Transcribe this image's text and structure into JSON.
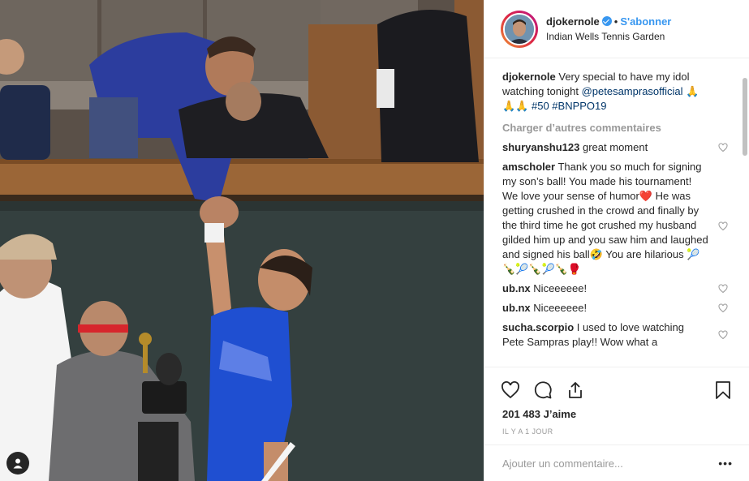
{
  "post": {
    "username": "djokernole",
    "follow_label": "S'abonner",
    "separator": "•",
    "location": "Indian Wells Tennis Garden"
  },
  "caption": {
    "username": "djokernole",
    "text_1": "Very special to have my idol watching tonight",
    "mention": "@petesamprasofficial",
    "text_2": "🙏 🙏🙏",
    "tags": "#50 #BNPPO19"
  },
  "load_more_label": "Charger d’autres commentaires",
  "comments": [
    {
      "username": "shuryanshu123",
      "text": "great moment"
    },
    {
      "username": "amscholer",
      "text": "Thank you so much for signing my son’s ball! You made his tournament! We love your sense of humor❤️ He was getting crushed in the crowd and finally by the third time he got crushed my husband gilded him up and you saw him and laughed and signed his ball🤣 You are hilarious 🎾🍾🎾🍾🎾🍾🥊"
    },
    {
      "username": "ub.nx",
      "text": "Niceeeeee!"
    },
    {
      "username": "ub.nx",
      "text": "Niceeeeee!"
    },
    {
      "username": "sucha.scorpio",
      "text": "I used to love watching Pete Sampras play!! Wow what a"
    }
  ],
  "likes_label": "201 483 J’aime",
  "time_label": "IL Y A 1 JOUR",
  "add_comment_placeholder": "Ajouter un commentaire...",
  "more_label": "•••",
  "icons": {
    "like": "heart-icon",
    "comment": "comment-icon",
    "share": "share-icon",
    "save": "bookmark-icon",
    "tag": "user-tag-icon"
  },
  "colors": {
    "accent": "#3897f0",
    "text": "#262626",
    "muted": "#999999",
    "link": "#003569"
  }
}
